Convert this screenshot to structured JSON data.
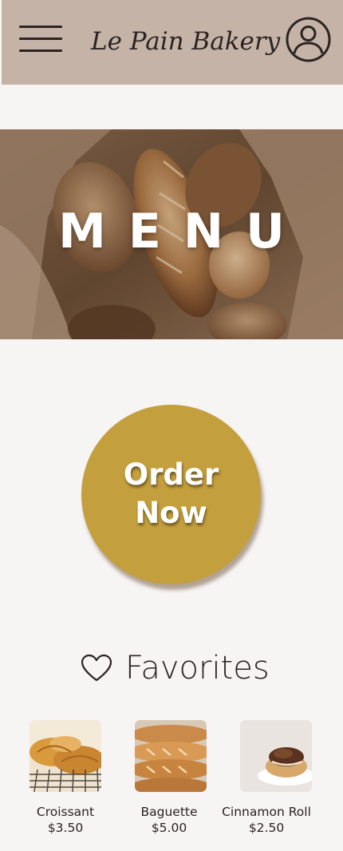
{
  "header": {
    "brand": "Le Pain Bakery",
    "menu_icon": "hamburger-menu-icon",
    "account_icon": "user-account-icon"
  },
  "hero": {
    "title": "MENU"
  },
  "order": {
    "label_line1": "Order",
    "label_line2": "Now"
  },
  "favorites": {
    "icon": "heart-icon",
    "title": "Favorites",
    "items": [
      {
        "name": "Croissant",
        "price": "$3.50"
      },
      {
        "name": "Baguette",
        "price": "$5.00"
      },
      {
        "name": "Cinnamon Roll",
        "price": "$2.50"
      }
    ]
  },
  "colors": {
    "header_bg": "#c5b3a8",
    "page_bg": "#f7f4f4",
    "accent_gold": "#c49f3d",
    "text": "#2a2422"
  }
}
